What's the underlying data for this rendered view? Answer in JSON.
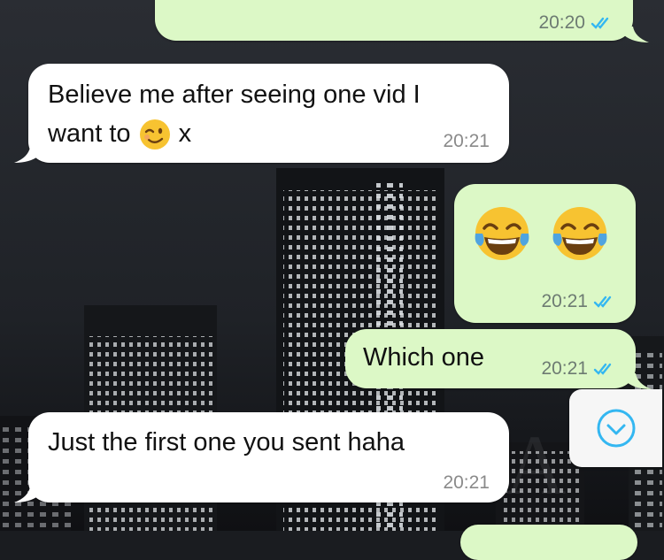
{
  "colors": {
    "incoming_bubble": "#ffffff",
    "outgoing_bubble": "#dcf8c6",
    "read_ticks": "#34b7f1",
    "scroll_icon": "#34b7f1"
  },
  "messages": [
    {
      "direction": "outgoing",
      "time": "20:20",
      "status": "read"
    },
    {
      "direction": "incoming",
      "text_line1": "Believe me after seeing one vid I",
      "text_line2_prefix": "want to",
      "emoji": "winking-face",
      "text_line2_suffix": "x",
      "time": "20:21"
    },
    {
      "direction": "outgoing",
      "emoji": [
        "face-with-tears-of-joy",
        "face-with-tears-of-joy"
      ],
      "time": "20:21",
      "status": "read"
    },
    {
      "direction": "outgoing",
      "text": "Which one",
      "time": "20:21",
      "status": "read"
    },
    {
      "direction": "incoming",
      "text": "Just the first one you sent haha",
      "time": "20:21"
    }
  ],
  "scroll_button": {
    "icon": "chevron-down-circle-icon"
  },
  "watermark": "EROBELLA"
}
